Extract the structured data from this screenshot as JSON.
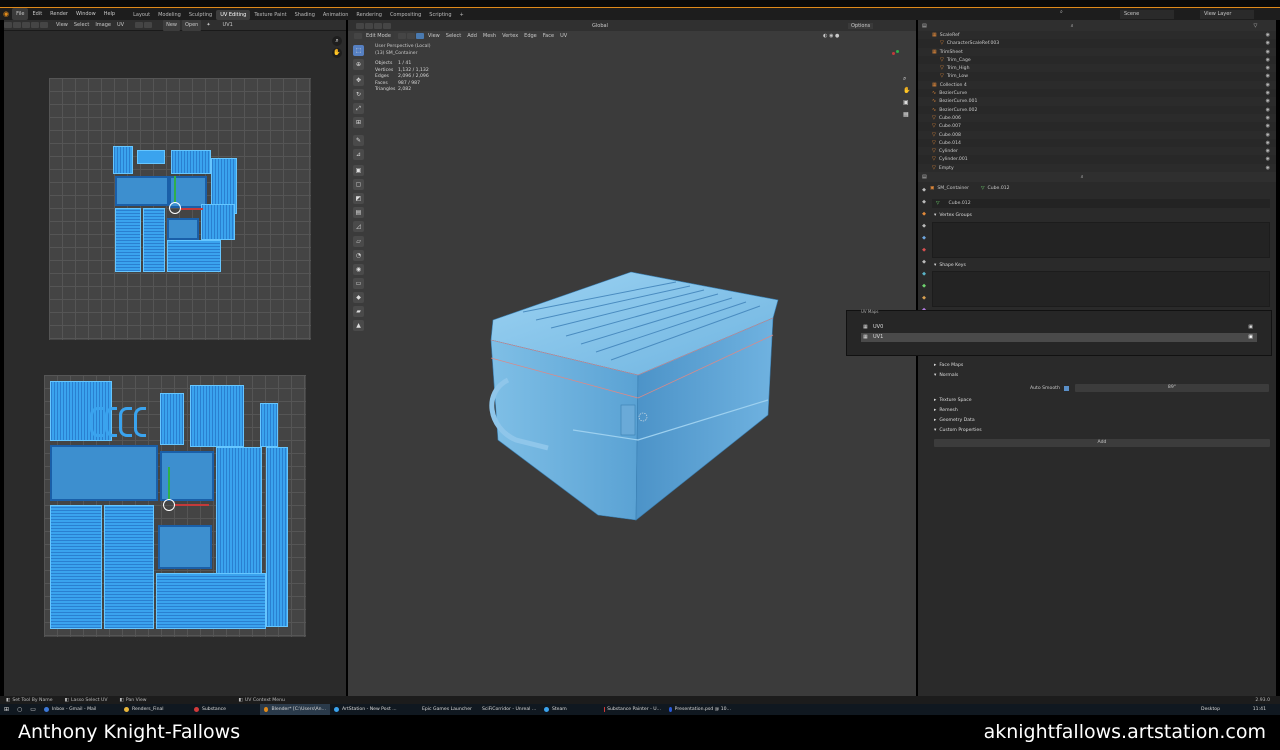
{
  "top_menu": [
    "File",
    "Edit",
    "Render",
    "Window",
    "Help"
  ],
  "workspaces": [
    "Layout",
    "Modeling",
    "Sculpting",
    "UV Editing",
    "Texture Paint",
    "Shading",
    "Animation",
    "Rendering",
    "Compositing",
    "Scripting"
  ],
  "active_workspace": "UV Editing",
  "scene_label": "Scene",
  "view_layer_label": "View Layer",
  "uv_editor": {
    "menu": [
      "View",
      "Select",
      "Image",
      "UV"
    ],
    "new_label": "New",
    "open_label": "Open",
    "uvmap_label": "UV1"
  },
  "viewport": {
    "mode": "Edit Mode",
    "menu": [
      "View",
      "Select",
      "Add",
      "Mesh",
      "Vertex",
      "Edge",
      "Face",
      "UV"
    ],
    "orientation": "Global",
    "options_label": "Options",
    "title": "User Perspective (Local)",
    "object_label": "(13) SM_Container",
    "stats": [
      {
        "label": "Objects",
        "value": "1 / 41"
      },
      {
        "label": "Vertices",
        "value": "1,132 / 1,132"
      },
      {
        "label": "Edges",
        "value": "2,096 / 2,096"
      },
      {
        "label": "Faces",
        "value": "987 / 987"
      },
      {
        "label": "Triangles",
        "value": "2,082"
      }
    ]
  },
  "outliner": {
    "items": [
      {
        "name": "ScaleRef",
        "indent": 1
      },
      {
        "name": "CharacterScaleRef.003",
        "indent": 2
      },
      {
        "name": "TrimSheet",
        "indent": 1
      },
      {
        "name": "Trim_Cage",
        "indent": 2
      },
      {
        "name": "Trim_High",
        "indent": 2
      },
      {
        "name": "Trim_Low",
        "indent": 2
      },
      {
        "name": "Collection 4",
        "indent": 1
      },
      {
        "name": "BezierCurve",
        "indent": 1
      },
      {
        "name": "BezierCurve.001",
        "indent": 1
      },
      {
        "name": "BezierCurve.002",
        "indent": 1
      },
      {
        "name": "Cube.006",
        "indent": 1
      },
      {
        "name": "Cube.007",
        "indent": 1
      },
      {
        "name": "Cube.008",
        "indent": 1
      },
      {
        "name": "Cube.014",
        "indent": 1
      },
      {
        "name": "Cylinder",
        "indent": 1
      },
      {
        "name": "Cylinder.001",
        "indent": 1
      },
      {
        "name": "Empty",
        "indent": 1
      }
    ]
  },
  "properties": {
    "object_name": "SM_Container",
    "mesh_name": "Cube.012",
    "mesh_field": "Cube.012",
    "vertex_groups": "Vertex Groups",
    "shape_keys": "Shape Keys",
    "uv_maps_title": "UV Maps",
    "uv_maps": [
      "UV0",
      "UV1"
    ],
    "face_maps": "Face Maps",
    "normals": "Normals",
    "auto_smooth": "Auto Smooth",
    "auto_smooth_angle": "89°",
    "texture_space": "Texture Space",
    "remesh": "Remesh",
    "geometry_data": "Geometry Data",
    "custom_properties": "Custom Properties",
    "add_label": "Add"
  },
  "status": {
    "left_items": [
      "Set Tool By Name",
      "Lasso Select UV",
      "Pan View",
      "UV Context Menu"
    ],
    "version": "2.93.0"
  },
  "taskbar": {
    "items": [
      "Inbox - Gmail - Mail",
      "Renders_Final",
      "Substance",
      "Blender* [C:\\Users\\An...",
      "ArtStation - New Post ...",
      "Epic Games Launcher",
      "SciFiCorridor - Unreal ...",
      "Steam",
      "Substance Painter - U...",
      "Presentation.psd @ 10..."
    ],
    "desktop": "Desktop",
    "time": "11:41"
  },
  "footer": {
    "author": "Anthony Knight-Fallows",
    "site": "aknightfallows.artstation.com"
  },
  "colors": {
    "accent": "#e08a1a",
    "uv_blue": "#3aa3ee",
    "mesh_blue": "#6ab3de",
    "viewport_bg": "#3b3b3b"
  }
}
